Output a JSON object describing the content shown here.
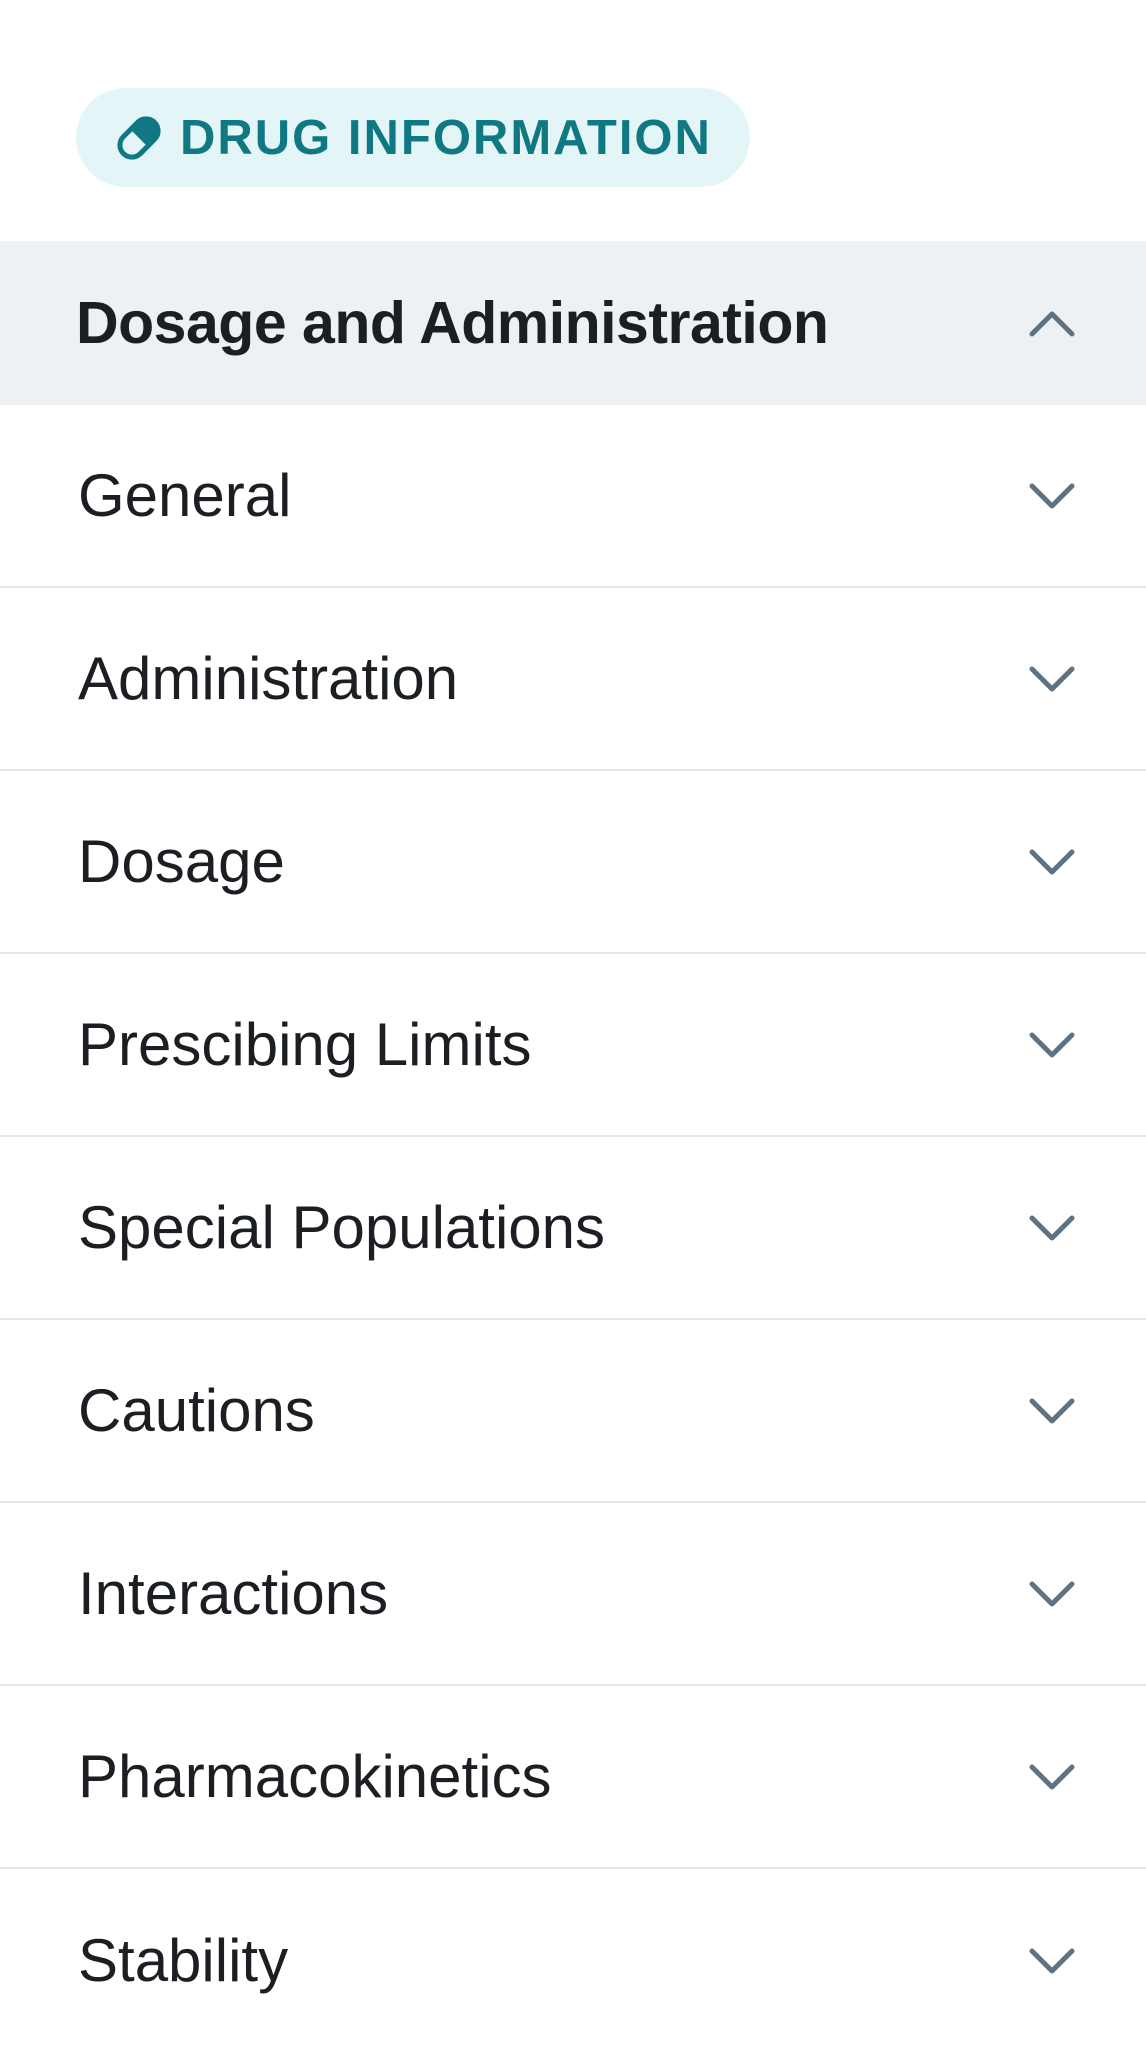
{
  "badge": {
    "icon": "pill-icon",
    "label": "DRUG INFORMATION"
  },
  "section": {
    "title": "Dosage and Administration",
    "state_icon": "chevron-up-icon"
  },
  "items": [
    {
      "label": "General",
      "icon": "chevron-down-icon"
    },
    {
      "label": "Administration",
      "icon": "chevron-down-icon"
    },
    {
      "label": "Dosage",
      "icon": "chevron-down-icon"
    },
    {
      "label": "Prescibing Limits",
      "icon": "chevron-down-icon"
    },
    {
      "label": "Special Populations",
      "icon": "chevron-down-icon"
    },
    {
      "label": "Cautions",
      "icon": "chevron-down-icon"
    },
    {
      "label": "Interactions",
      "icon": "chevron-down-icon"
    },
    {
      "label": "Pharmacokinetics",
      "icon": "chevron-down-icon"
    },
    {
      "label": "Stability",
      "icon": "chevron-down-icon"
    }
  ],
  "colors": {
    "accent": "#0f7883",
    "badge_bg": "#e4f5f7",
    "header_bg": "#edf1f4",
    "chevron": "#5f7282"
  }
}
